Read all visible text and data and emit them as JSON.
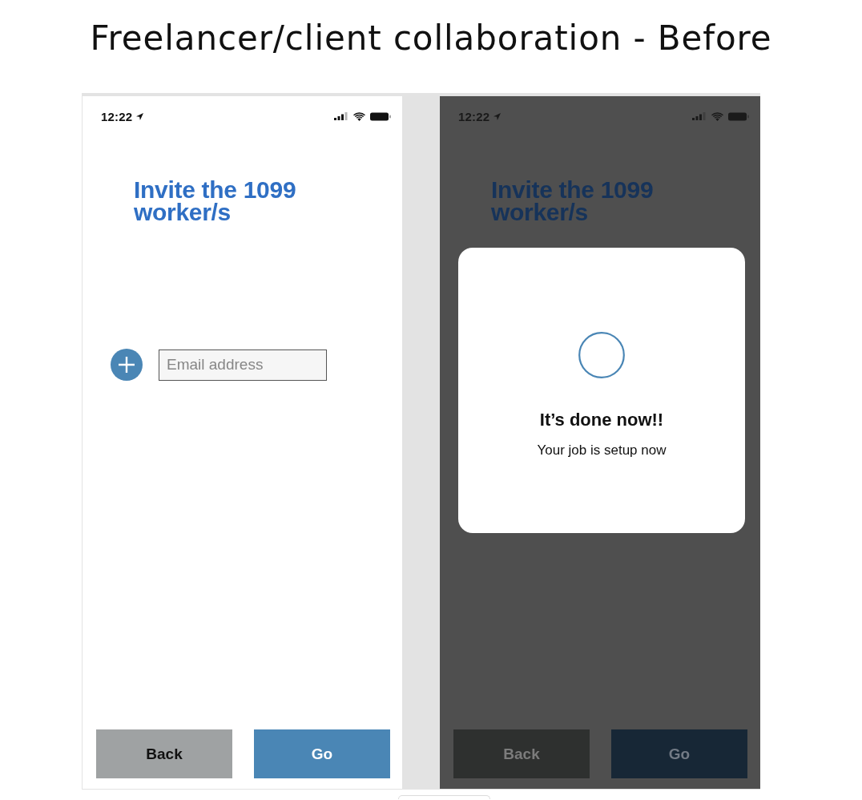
{
  "title": "Freelancer/client collaboration - Before",
  "screens": [
    {
      "dimmed": false,
      "status_bar": {
        "time": "12:22"
      },
      "heading": "Invite the 1099 worker/s",
      "email_field": {
        "placeholder": "Email address"
      },
      "buttons": [
        {
          "label": "Back",
          "kind": "secondary"
        },
        {
          "label": "Go",
          "kind": "primary"
        }
      ]
    },
    {
      "dimmed": true,
      "status_bar": {
        "time": "12:22"
      },
      "heading": "Invite the 1099 worker/s",
      "dialog": {
        "title": "It’s done now!!",
        "message": "Your job is setup now"
      },
      "buttons": [
        {
          "label": "Back",
          "kind": "secondary"
        },
        {
          "label": "Go",
          "kind": "primary"
        }
      ]
    }
  ]
}
